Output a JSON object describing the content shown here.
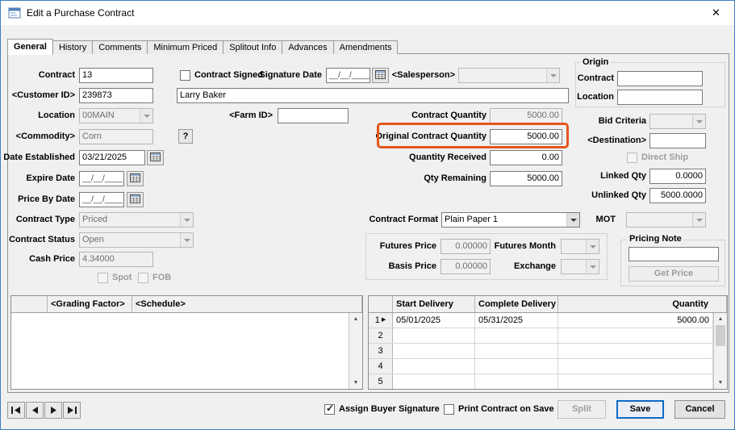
{
  "window": {
    "title": "Edit a Purchase Contract"
  },
  "icons": {
    "app": "form-window",
    "close": "✕",
    "calendar": "calendar-grid",
    "combo_arrow": "css-triangle-down",
    "check": "✓",
    "row_marker": "▶",
    "scroll_up": "▲",
    "scroll_down": "▼",
    "nav_first": "first-record",
    "nav_prev": "previous-record",
    "nav_next": "next-record",
    "nav_last": "last-record"
  },
  "tabs": {
    "items": [
      "General",
      "History",
      "Comments",
      "Minimum Priced",
      "Splitout Info",
      "Advances",
      "Amendments"
    ],
    "active": "General"
  },
  "labels": {
    "contract": "Contract",
    "contract_signed": "Contract Signed",
    "signature_date": "Signature Date",
    "salesperson": "<Salesperson>",
    "customer_id": "<Customer ID>",
    "location": "Location",
    "farm_id": "<Farm ID>",
    "contract_quantity": "Contract Quantity",
    "commodity": "<Commodity>",
    "help": "?",
    "original_contract_quantity": "Original Contract Quantity",
    "date_established": "Date Established",
    "quantity_received": "Quantity Received",
    "expire_date": "Expire Date",
    "qty_remaining": "Qty Remaining",
    "price_by_date": "Price By Date",
    "contract_type": "Contract Type",
    "contract_format": "Contract Format",
    "contract_status": "Contract Status",
    "futures_price": "Futures Price",
    "futures_month": "Futures Month",
    "cash_price": "Cash Price",
    "basis_price": "Basis Price",
    "exchange": "Exchange",
    "spot": "Spot",
    "fob": "FOB",
    "origin_group": "Origin",
    "origin_contract": "Contract",
    "origin_location": "Location",
    "bid_criteria": "Bid Criteria",
    "destination": "<Destination>",
    "direct_ship": "Direct Ship",
    "linked_qty": "Linked Qty",
    "unlinked_qty": "Unlinked Qty",
    "mot": "MOT",
    "pricing_note_group": "Pricing Note",
    "get_price": "Get Price"
  },
  "values": {
    "contract": "13",
    "customer_id": "239873",
    "customer_name": "Larry Baker",
    "location": "00MAIN",
    "farm_id": "",
    "commodity": "Corn",
    "date_established": "03/21/2025",
    "expire_date": "__/__/____",
    "price_by_date": "__/__/____",
    "signature_date": "__/__/____",
    "salesperson": "",
    "contract_type": "Priced",
    "contract_status": "Open",
    "cash_price": "4.34000",
    "contract_quantity": "5000.00",
    "original_contract_quantity": "5000.00",
    "quantity_received": "0.00",
    "qty_remaining": "5000.00",
    "contract_format": "Plain Paper 1",
    "futures_price": "0.00000",
    "futures_month": "",
    "basis_price": "0.00000",
    "exchange": "",
    "origin_contract": "",
    "origin_location": "",
    "bid_criteria": "",
    "destination": "",
    "linked_qty": "0.0000",
    "unlinked_qty": "5000.0000",
    "mot": "",
    "pricing_note": ""
  },
  "checkboxes": {
    "contract_signed": false,
    "spot": false,
    "fob": false,
    "direct_ship": false,
    "assign_buyer_signature": true,
    "print_contract_on_save": false
  },
  "grids": {
    "grading": {
      "headers": [
        "",
        "<Grading Factor>",
        "<Schedule>"
      ]
    },
    "delivery": {
      "headers": [
        "",
        "Start Delivery",
        "Complete Delivery",
        "Quantity"
      ],
      "rows": [
        {
          "num": "1",
          "start": "05/01/2025",
          "complete": "05/31/2025",
          "qty": "5000.00"
        },
        {
          "num": "2",
          "start": "",
          "complete": "",
          "qty": ""
        },
        {
          "num": "3",
          "start": "",
          "complete": "",
          "qty": ""
        },
        {
          "num": "4",
          "start": "",
          "complete": "",
          "qty": ""
        },
        {
          "num": "5",
          "start": "",
          "complete": "",
          "qty": ""
        }
      ]
    }
  },
  "footer": {
    "assign_buyer_signature": "Assign Buyer Signature",
    "print_contract_on_save": "Print Contract on Save",
    "split": "Split",
    "save": "Save",
    "cancel": "Cancel"
  },
  "annotation": {
    "highlight_color": "#e2571c",
    "target_field": "Original Contract Quantity"
  }
}
